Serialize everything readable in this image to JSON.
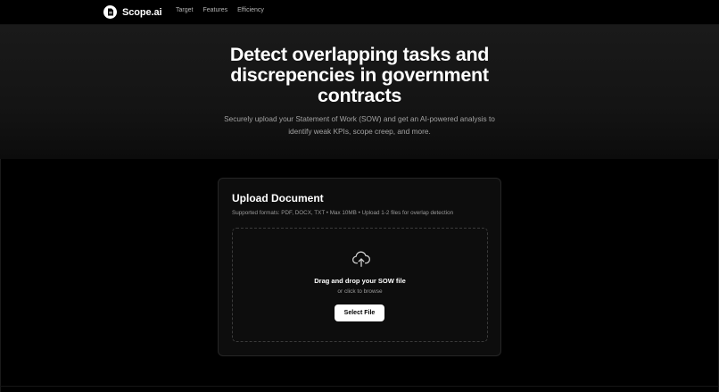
{
  "nav": {
    "brand": "Scope.ai",
    "links": [
      "Target",
      "Features",
      "Efficiency"
    ]
  },
  "hero": {
    "title_lines": [
      "Detect overlapping tasks and",
      "discrepencies in government",
      "contracts"
    ],
    "subtitle_lines": [
      "Securely upload your Statement of Work (SOW) and get an AI-powered analysis to",
      "identify weak KPIs, scope creep, and more."
    ]
  },
  "upload": {
    "title": "Upload Document",
    "description": "Supported formats: PDF, DOCX, TXT • Max 10MB • Upload 1-2 files for overlap detection",
    "drop_title": "Drag and drop your SOW file",
    "drop_sub": "or click to browse",
    "button_label": "Select File",
    "icon": "cloud-upload-icon"
  },
  "colors": {
    "background": "#000000",
    "hero_bg": "#1a1a1a",
    "card_bg": "#0d0d0d",
    "accent_button": "#ffffff"
  }
}
